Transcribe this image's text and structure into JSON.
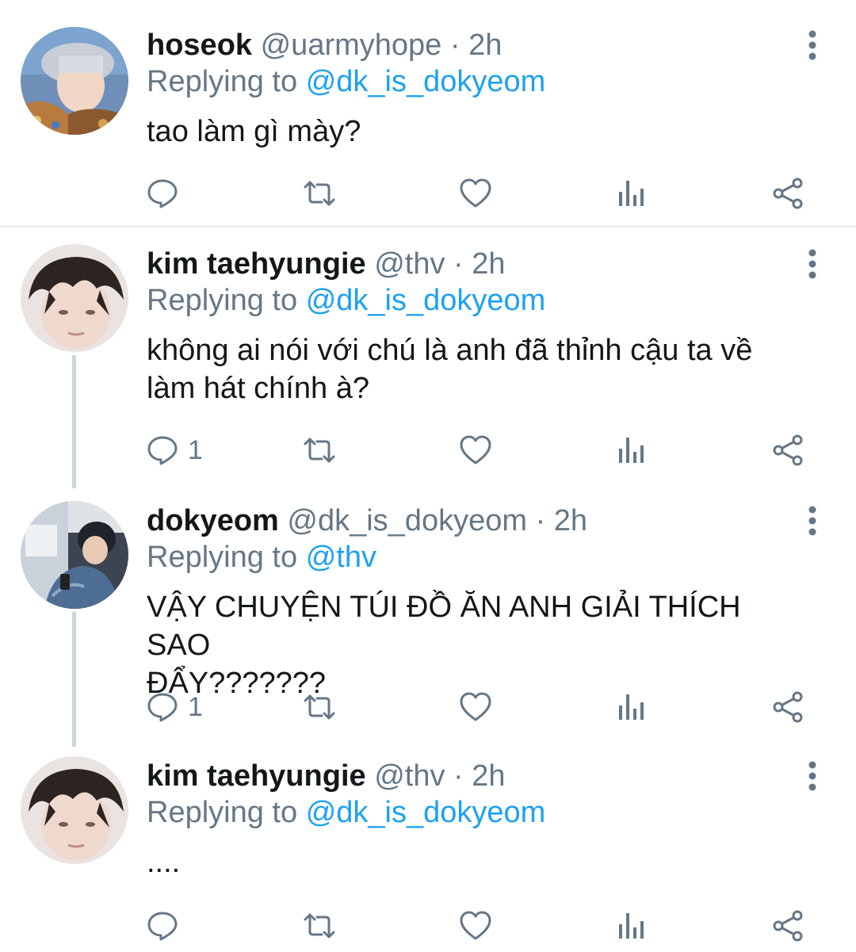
{
  "tweets": [
    {
      "name": "hoseok",
      "handle": "@uarmyhope",
      "dot": "·",
      "time": "2h",
      "replying_prefix": "Replying to",
      "replying_to": "@dk_is_dokyeom",
      "text": "tao làm gì mày?",
      "reply_count": ""
    },
    {
      "name": "kim taehyungie",
      "handle": "@thv",
      "dot": "·",
      "time": "2h",
      "replying_prefix": "Replying to",
      "replying_to": "@dk_is_dokyeom",
      "text_line1": "không ai nói với chú là anh đã thỉnh cậu ta về",
      "text_line2": "làm hát chính à?",
      "reply_count": "1"
    },
    {
      "name": "dokyeom",
      "handle": "@dk_is_dokyeom",
      "dot": "·",
      "time": "2h",
      "replying_prefix": "Replying to",
      "replying_to": "@thv",
      "text_line1": "VẬY CHUYỆN TÚI ĐỒ ĂN ANH GIẢI THÍCH SAO",
      "text_line2": "ĐẨY???????",
      "reply_count": "1"
    },
    {
      "name": "kim taehyungie",
      "handle": "@thv",
      "dot": "·",
      "time": "2h",
      "replying_prefix": "Replying to",
      "replying_to": "@dk_is_dokyeom",
      "text": "....",
      "reply_count": ""
    }
  ],
  "icons": {
    "reply": "reply-icon",
    "retweet": "retweet-icon",
    "like": "heart-icon",
    "analytics": "analytics-icon",
    "share": "share-icon",
    "more": "more-vertical-icon"
  },
  "colors": {
    "link": "#1da1f2",
    "secondary_text": "#657786",
    "icon": "#657786",
    "thread_line": "#ccd6dd"
  }
}
